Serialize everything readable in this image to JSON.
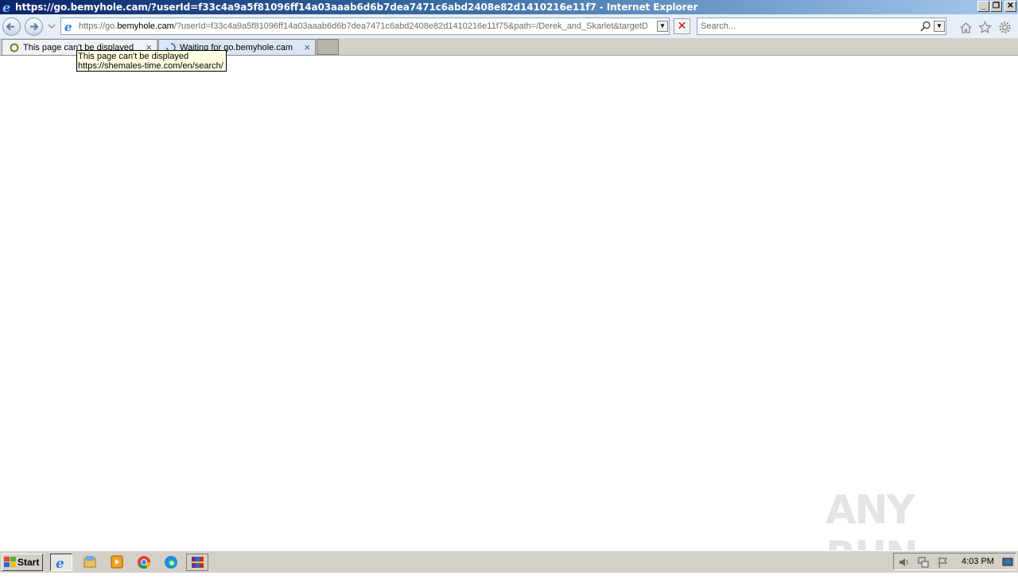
{
  "window": {
    "title": "https://go.bemyhole.cam/?userId=f33c4a9a5f81096ff14a03aaab6d6b7dea7471c6abd2408e82d1410216e11f7 - Internet Explorer",
    "buttons": {
      "minimize": "_",
      "restore": "❐",
      "close": "✕"
    }
  },
  "address_bar": {
    "url_prefix": "https://go.",
    "url_domain": "bemyhole.cam",
    "url_rest": "/?userId=f33c4a9a5f81096ff14a03aaab6d6b7dea7471c6abd2408e82d1410216e11f75&path=/Derek_and_Skarlet&targetDc"
  },
  "search": {
    "placeholder": "Search..."
  },
  "tabs": [
    {
      "label": "This page can't be displayed",
      "icon": "error-page-icon",
      "active": true
    },
    {
      "label": "Waiting for go.bemyhole.cam",
      "icon": "loading-spinner-icon",
      "active": false
    }
  ],
  "tooltip": {
    "line1": "This page can't be displayed",
    "line2": "https://shemales-time.com/en/search/"
  },
  "watermark": {
    "text": "ANY RUN"
  },
  "taskbar": {
    "start_label": "Start",
    "apps": [
      "internet-explorer-icon",
      "file-explorer-icon",
      "media-player-icon",
      "chrome-icon",
      "edge-icon",
      "winrar-icon"
    ],
    "clock": "4:03 PM"
  },
  "colors": {
    "title_bar_start": "#0a246a",
    "title_bar_end": "#a6caf0",
    "tooltip_bg": "#ffffe1",
    "stop_red": "#cc0000"
  }
}
